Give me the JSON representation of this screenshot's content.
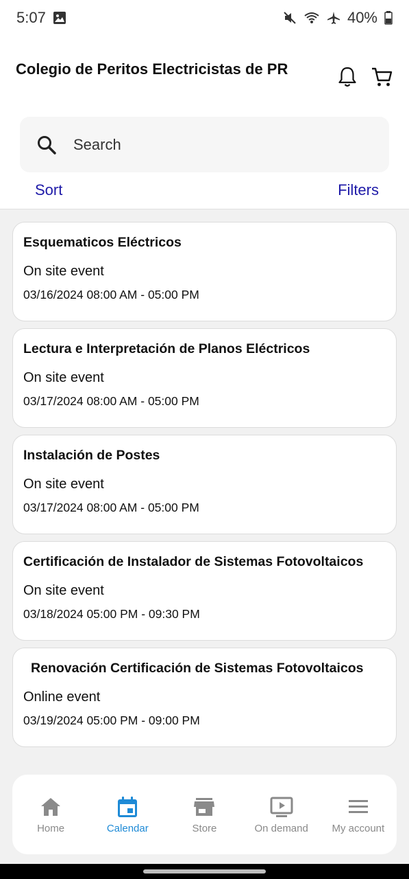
{
  "status_bar": {
    "time": "5:07",
    "battery": "40%",
    "icons": [
      "gallery-icon",
      "mute-icon",
      "wifi-icon",
      "airplane-icon",
      "battery-icon"
    ]
  },
  "header": {
    "title": "Colegio de Peritos Electricistas de PR",
    "icons": [
      "bell-icon",
      "cart-icon"
    ]
  },
  "search": {
    "placeholder": "Search",
    "value": ""
  },
  "controls": {
    "sort_label": "Sort",
    "filters_label": "Filters"
  },
  "events": [
    {
      "title": "Esquematicos Eléctricos",
      "type": "On site event",
      "datetime": "03/16/2024 08:00 AM - 05:00 PM"
    },
    {
      "title": "Lectura e Interpretación de Planos Eléctricos",
      "type": "On site event",
      "datetime": "03/17/2024 08:00 AM - 05:00 PM"
    },
    {
      "title": "Instalación de Postes",
      "type": "On site event",
      "datetime": "03/17/2024 08:00 AM - 05:00 PM"
    },
    {
      "title": "Certificación de Instalador de Sistemas Fotovoltaicos",
      "type": "On site event",
      "datetime": "03/18/2024 05:00 PM - 09:30 PM"
    },
    {
      "title": "Renovación Certificación de Sistemas Fotovoltaicos",
      "type": "Online event",
      "datetime": "03/19/2024 05:00 PM - 09:00 PM"
    }
  ],
  "bottom_nav": {
    "items": [
      {
        "label": "Home",
        "icon": "home-icon",
        "active": false
      },
      {
        "label": "Calendar",
        "icon": "calendar-icon",
        "active": true
      },
      {
        "label": "Store",
        "icon": "store-icon",
        "active": false
      },
      {
        "label": "On demand",
        "icon": "play-icon",
        "active": false
      },
      {
        "label": "My account",
        "icon": "menu-icon",
        "active": false
      }
    ]
  },
  "colors": {
    "accent": "#1e8ad6",
    "link": "#1e1aa8",
    "inactive": "#8a8a8a"
  }
}
